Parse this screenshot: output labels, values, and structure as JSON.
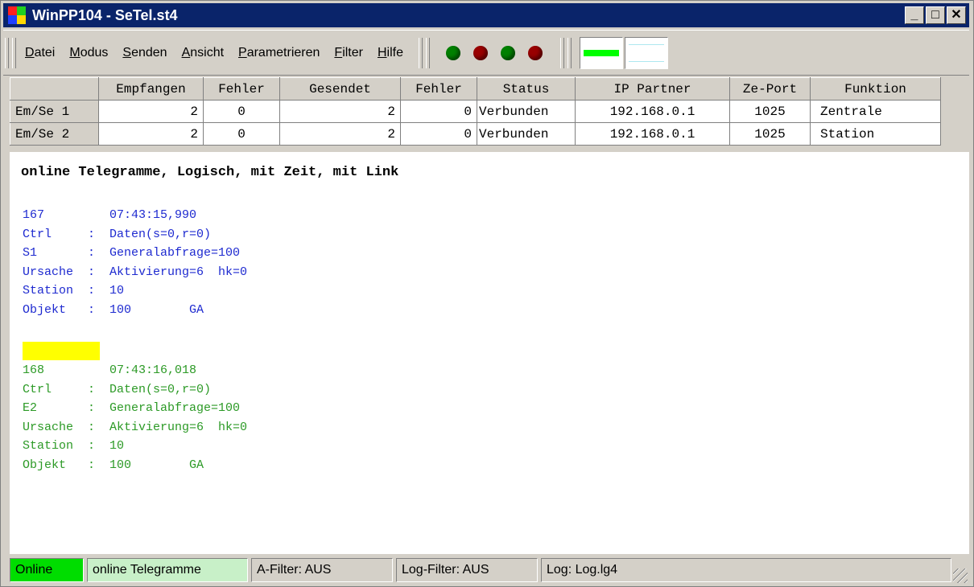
{
  "window": {
    "title": "WinPP104 - SeTel.st4",
    "minimize": "_",
    "maximize": "□",
    "close": "✕"
  },
  "menu": {
    "items": [
      {
        "first": "D",
        "rest": "atei"
      },
      {
        "first": "M",
        "rest": "odus"
      },
      {
        "first": "S",
        "rest": "enden"
      },
      {
        "first": "A",
        "rest": "nsicht"
      },
      {
        "first": "P",
        "rest": "arametrieren"
      },
      {
        "first": "F",
        "rest": "ilter"
      },
      {
        "first": "H",
        "rest": "ilfe"
      }
    ],
    "leds": [
      "#008000",
      "#990000",
      "#008000",
      "#990000"
    ],
    "swatch1": "#00ff00",
    "swatch2": "#aee8f0"
  },
  "table": {
    "headers": [
      "",
      "Empfangen",
      "Fehler",
      "Gesendet",
      "Fehler",
      "Status",
      "IP Partner",
      "Ze-Port",
      "Funktion"
    ],
    "rows": [
      [
        "Em/Se 1",
        "2",
        "0",
        "2",
        "0",
        "Verbunden",
        "192.168.0.1",
        "1025",
        "Zentrale"
      ],
      [
        "Em/Se 2",
        "2",
        "0",
        "2",
        "0",
        "Verbunden",
        "192.168.0.1",
        "1025",
        "Station"
      ]
    ]
  },
  "log": {
    "title": "online Telegramme, Logisch, mit Zeit, mit Link",
    "tele1": [
      "167         07:43:15,990",
      "Ctrl     :  Daten(s=0,r=0)",
      "S1       :  Generalabfrage=100",
      "Ursache  :  Aktivierung=6  hk=0",
      "Station  :  10",
      "Objekt   :  100        GA"
    ],
    "tele2": [
      "168         07:43:16,018",
      "Ctrl     :  Daten(s=0,r=0)",
      "E2       :  Generalabfrage=100",
      "Ursache  :  Aktivierung=6  hk=0",
      "Station  :  10",
      "Objekt   :  100        GA"
    ]
  },
  "status": {
    "mode": "Online",
    "view": "online Telegramme",
    "afilter": "A-Filter: AUS",
    "logfilter": "Log-Filter: AUS",
    "log": "Log: Log.lg4",
    "mode_color": "#00dd00",
    "view_color": "#c8f0c8"
  }
}
